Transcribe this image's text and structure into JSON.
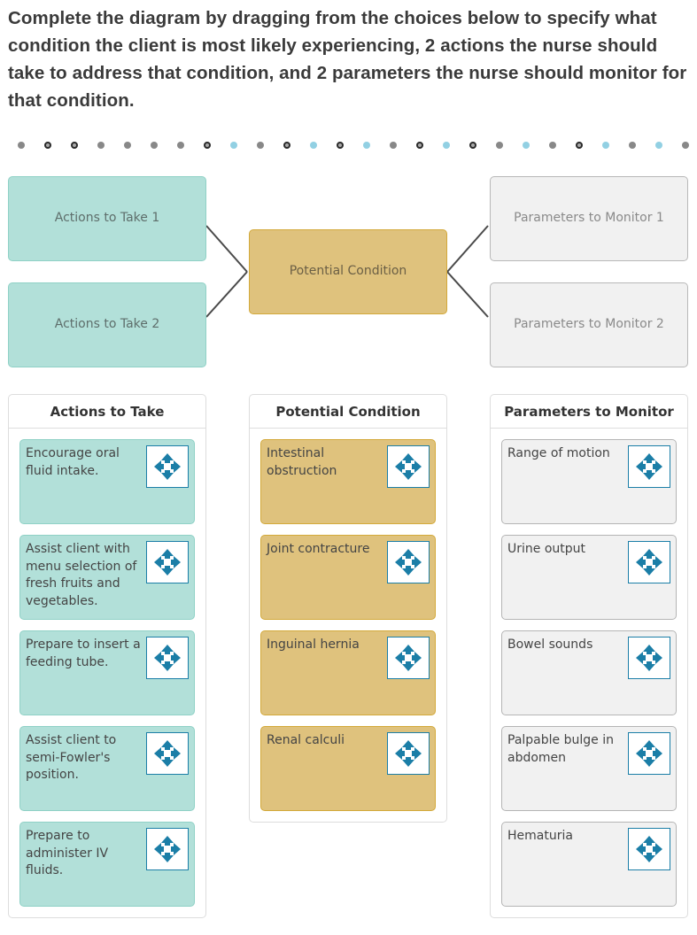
{
  "question": "Complete the diagram by dragging from the choices below to specify what condition the client is most likely experiencing, 2 actions the nurse should take to address that condition, and 2 parameters the nurse should monitor for that condition.",
  "progress_dots": [
    "grey",
    "ring",
    "ring",
    "grey",
    "grey",
    "grey",
    "grey",
    "ring",
    "blue",
    "grey",
    "ring",
    "blue",
    "ring",
    "blue",
    "grey",
    "ring",
    "blue",
    "ring",
    "grey",
    "blue",
    "grey",
    "ring",
    "blue",
    "grey",
    "blue",
    "grey"
  ],
  "diagram": {
    "actions_slot_1": "Actions to Take 1",
    "actions_slot_2": "Actions to Take 2",
    "condition_slot": "Potential Condition",
    "parameters_slot_1": "Parameters to Monitor 1",
    "parameters_slot_2": "Parameters to Monitor 2"
  },
  "panels": {
    "actions": {
      "title": "Actions to Take",
      "items": [
        "Encourage oral fluid intake.",
        "Assist client with menu selection of fresh fruits and vegetables.",
        "Prepare to insert a feeding tube.",
        "Assist client to semi-Fowler's position.",
        "Prepare to administer IV fluids."
      ]
    },
    "conditions": {
      "title": "Potential Condition",
      "items": [
        "Intestinal obstruction",
        "Joint contracture",
        "Inguinal hernia",
        "Renal calculi"
      ]
    },
    "parameters": {
      "title": "Parameters to Monitor",
      "items": [
        "Range of motion",
        "Urine output",
        "Bowel sounds",
        "Palpable bulge in abdomen",
        "Hematuria"
      ]
    }
  },
  "icons": {
    "drag_handle": "move-arrows-icon"
  },
  "colors": {
    "actions_fill": "#b2e0d9",
    "condition_fill": "#dfc27d",
    "parameters_fill": "#f1f1f1",
    "handle_accent": "#1b7ea7"
  }
}
